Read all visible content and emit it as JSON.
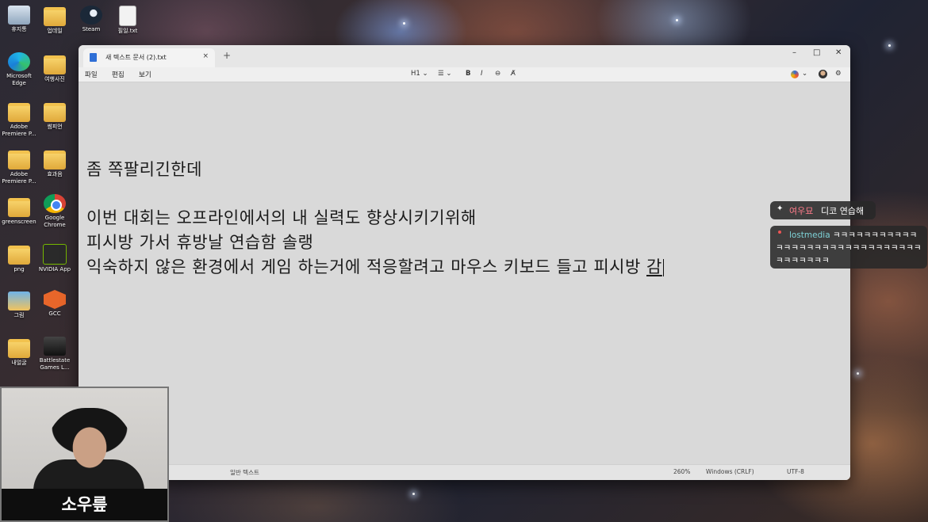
{
  "desktop": {
    "icons": [
      {
        "label": "휴지통",
        "icon": "recycle-bin-icon"
      },
      {
        "label": "업데일",
        "icon": "folder-icon"
      },
      {
        "label": "Steam",
        "icon": "steam-icon"
      },
      {
        "label": "필일.txt",
        "icon": "text-file-icon"
      },
      {
        "label": "Microsoft Edge",
        "icon": "edge-icon"
      },
      {
        "label": "여행사진",
        "icon": "folder-icon"
      },
      {
        "label": "Adobe Premiere P...",
        "icon": "folder-icon"
      },
      {
        "label": "썸피언",
        "icon": "folder-icon"
      },
      {
        "label": "Adobe Premiere P...",
        "icon": "folder-icon"
      },
      {
        "label": "효과음",
        "icon": "folder-icon"
      },
      {
        "label": "greenscreen",
        "icon": "folder-icon"
      },
      {
        "label": "Google Chrome",
        "icon": "chrome-icon"
      },
      {
        "label": "png",
        "icon": "folder-icon"
      },
      {
        "label": "NVIDIA App",
        "icon": "nvidia-icon"
      },
      {
        "label": "그림",
        "icon": "pictures-icon"
      },
      {
        "label": "GCC",
        "icon": "gcc-icon"
      },
      {
        "label": "내얼굴",
        "icon": "folder-icon"
      },
      {
        "label": "Battlestate Games L...",
        "icon": "battlestate-icon"
      }
    ]
  },
  "notepad": {
    "tab_title": "새 텍스트 문서 (2).txt",
    "tab_close": "×",
    "new_tab": "+",
    "window_controls": {
      "minimize": "–",
      "maximize": "□",
      "close": "✕"
    },
    "menu": {
      "file": "파일",
      "edit": "편집",
      "view": "보기"
    },
    "toolbar": {
      "heading": "H1 ⌄",
      "list": "☰ ⌄",
      "bold": "B",
      "italic": "I",
      "link": "⊖",
      "clear_format": "A̸",
      "copilot": "⌄",
      "settings": "⚙"
    },
    "lines": [
      "좀 쪽팔리긴한데",
      "이번 대회는 오프라인에서의 내 실력도 향상시키기위해",
      "피시방 가서 휴방날 연습함 솔랭",
      "익숙하지 않은 환경에서 게임 하는거에 적응할려고 마우스 키보드 들고 피시방 "
    ],
    "cursor_char": "감",
    "status": {
      "format": "일반 텍스트",
      "zoom": "260%",
      "line_ending": "Windows (CRLF)",
      "encoding": "UTF-8"
    }
  },
  "chat": {
    "message1": {
      "user": "여우묘",
      "text": "디코 연습해"
    },
    "message2": {
      "user": "lostmedia",
      "text": "ㅋㅋㅋㅋㅋㅋㅋㅋㅋㅋㅋㅋㅋㅋㅋㅋㅋㅋㅋㅋㅋㅋㅋㅋㅋㅋㅋㅋㅋㅋㅋㅋㅋㅋㅋㅋㅋ"
    }
  },
  "webcam": {
    "streamer_name": "소우릎"
  },
  "colors": {
    "chat_user1": "#ff7b8a",
    "chat_user2": "#7fd3d8",
    "accent": "#2f6fd6"
  }
}
